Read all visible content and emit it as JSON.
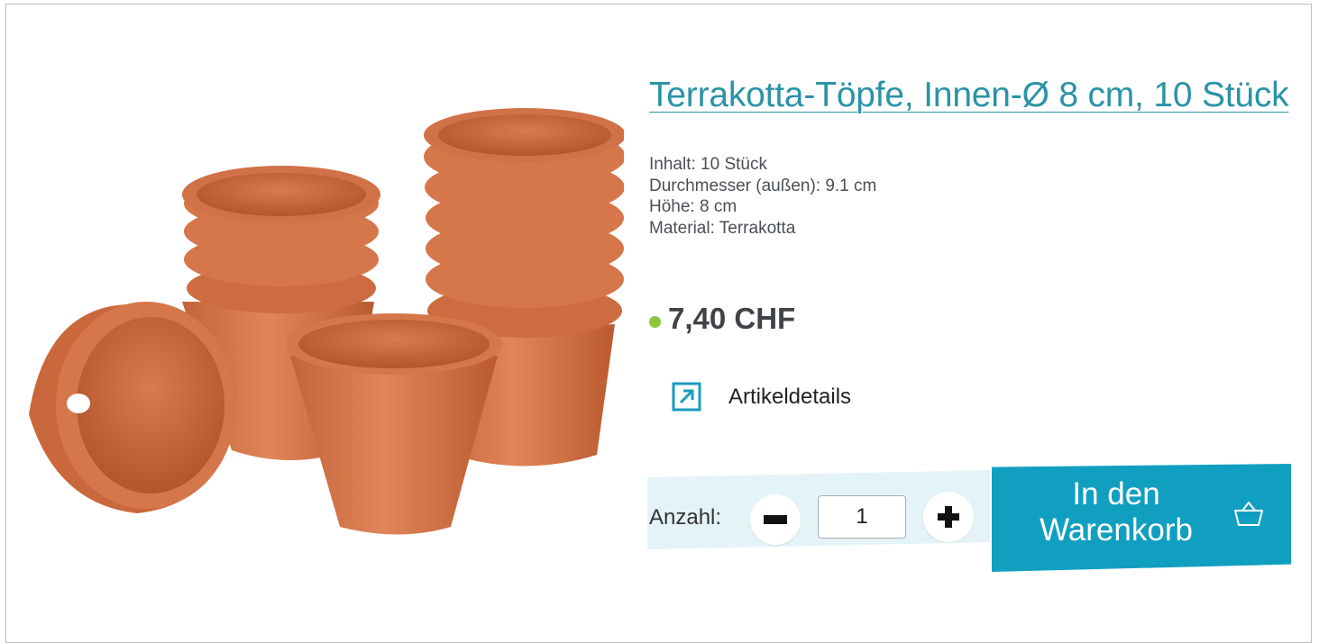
{
  "product": {
    "title": "Terrakotta-Töpfe, Innen-Ø 8 cm, 10 Stück",
    "image_alt": "Terrakotta-Töpfe",
    "specs": [
      "Inhalt: 10 Stück",
      "Durchmesser (außen): 9.1 cm",
      "Höhe: 8 cm",
      "Material: Terrakotta"
    ],
    "price": "7,40 CHF",
    "availability_color": "#8cc63f",
    "details_label": "Artikeldetails",
    "details_icon": "external-link-arrow-icon"
  },
  "quantity": {
    "label": "Anzahl:",
    "value": "1",
    "decrement_icon": "minus-icon",
    "increment_icon": "plus-icon"
  },
  "cart": {
    "label_line1": "In den",
    "label_line2": "Warenkorb",
    "icon": "basket-icon",
    "color": "#119fc1"
  },
  "colors": {
    "accent": "#2a93a7",
    "terracotta": "#c9683c"
  }
}
